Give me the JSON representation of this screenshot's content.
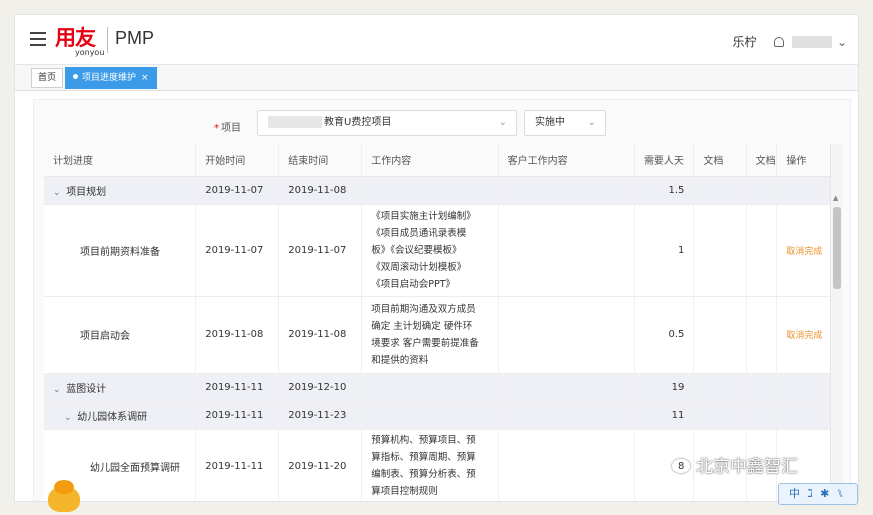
{
  "header": {
    "logo_text": "用友",
    "logo_sub": "yonyou",
    "app_name": "PMP",
    "user_name": "乐柠"
  },
  "tabs": {
    "home": "首页",
    "active": "项目进度维护",
    "close": "×"
  },
  "filters": {
    "required_mark": "*",
    "project_label": "项目",
    "project_value": "教育U费控项目",
    "status_value": "实施中"
  },
  "table": {
    "columns": [
      "计划进度",
      "开始时间",
      "结束时间",
      "工作内容",
      "客户工作内容",
      "需要人天",
      "文档",
      "文档",
      "操作"
    ],
    "rows": [
      {
        "level": 0,
        "expanded": true,
        "name": "项目规划",
        "start": "2019-11-07",
        "end": "2019-11-08",
        "work": [],
        "client": "",
        "days": "1.5",
        "action": ""
      },
      {
        "level": 1,
        "name": "项目前期资料准备",
        "start": "2019-11-07",
        "end": "2019-11-07",
        "work": [
          "《项目实施主计划编制》",
          "《项目成员通讯录表模",
          "板》《会议纪要模板》",
          "《双周滚动计划模板》",
          "《项目启动会PPT》"
        ],
        "client": "",
        "days": "1",
        "action": "取消完成"
      },
      {
        "level": 1,
        "name": "项目启动会",
        "start": "2019-11-08",
        "end": "2019-11-08",
        "work": [
          "项目前期沟通及双方成员",
          "确定 主计划确定 硬件环",
          "境要求 客户需要前提准备",
          "和提供的资料"
        ],
        "client": "",
        "days": "0.5",
        "action": "取消完成"
      },
      {
        "level": 0,
        "expanded": true,
        "name": "蓝图设计",
        "start": "2019-11-11",
        "end": "2019-12-10",
        "work": [],
        "client": "",
        "days": "19",
        "action": ""
      },
      {
        "level": 1,
        "expanded": true,
        "name": "幼儿园体系调研",
        "start": "2019-11-11",
        "end": "2019-11-23",
        "work": [],
        "client": "",
        "days": "11",
        "action": ""
      },
      {
        "level": 2,
        "name": "幼儿园全面预算调研",
        "start": "2019-11-11",
        "end": "2019-11-20",
        "work": [
          "预算机构、预算项目、预",
          "算指标、预算周期、预算",
          "编制表、预算分析表、预",
          "算项目控制规则"
        ],
        "client": "",
        "days": "8",
        "action": ""
      }
    ]
  },
  "watermark": "北京中鑫智汇",
  "ime_text": "中 ℷ ✱ ⑊"
}
